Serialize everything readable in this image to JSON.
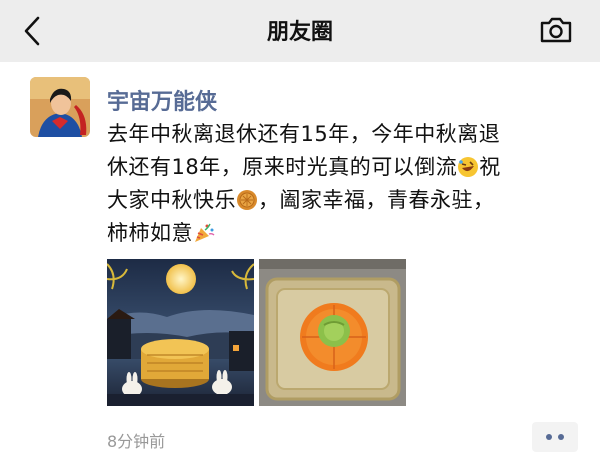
{
  "nav": {
    "title": "朋友圈",
    "back_icon": "chevron-left-icon",
    "camera_icon": "camera-icon"
  },
  "post": {
    "username": "宇宙万能侠",
    "lines": [
      "去年中秋离退休还有15年，今年中秋离退",
      "休还有18年，原来时光真的可以倒流",
      "祝",
      "大家中秋快乐",
      "，阖家幸福，青春永驻，",
      "柿柿如意"
    ],
    "emojis": [
      "rofl-emoji",
      "mooncake-emoji",
      "party-popper-emoji"
    ],
    "images": [
      {
        "description_icon": "mid-autumn-moon-image"
      },
      {
        "description_icon": "persimmon-cake-image"
      }
    ],
    "time": "8分钟前"
  },
  "colors": {
    "nav_bg": "#ededed",
    "username": "#576b95",
    "time": "#999999",
    "more_dots": "#576b95"
  }
}
